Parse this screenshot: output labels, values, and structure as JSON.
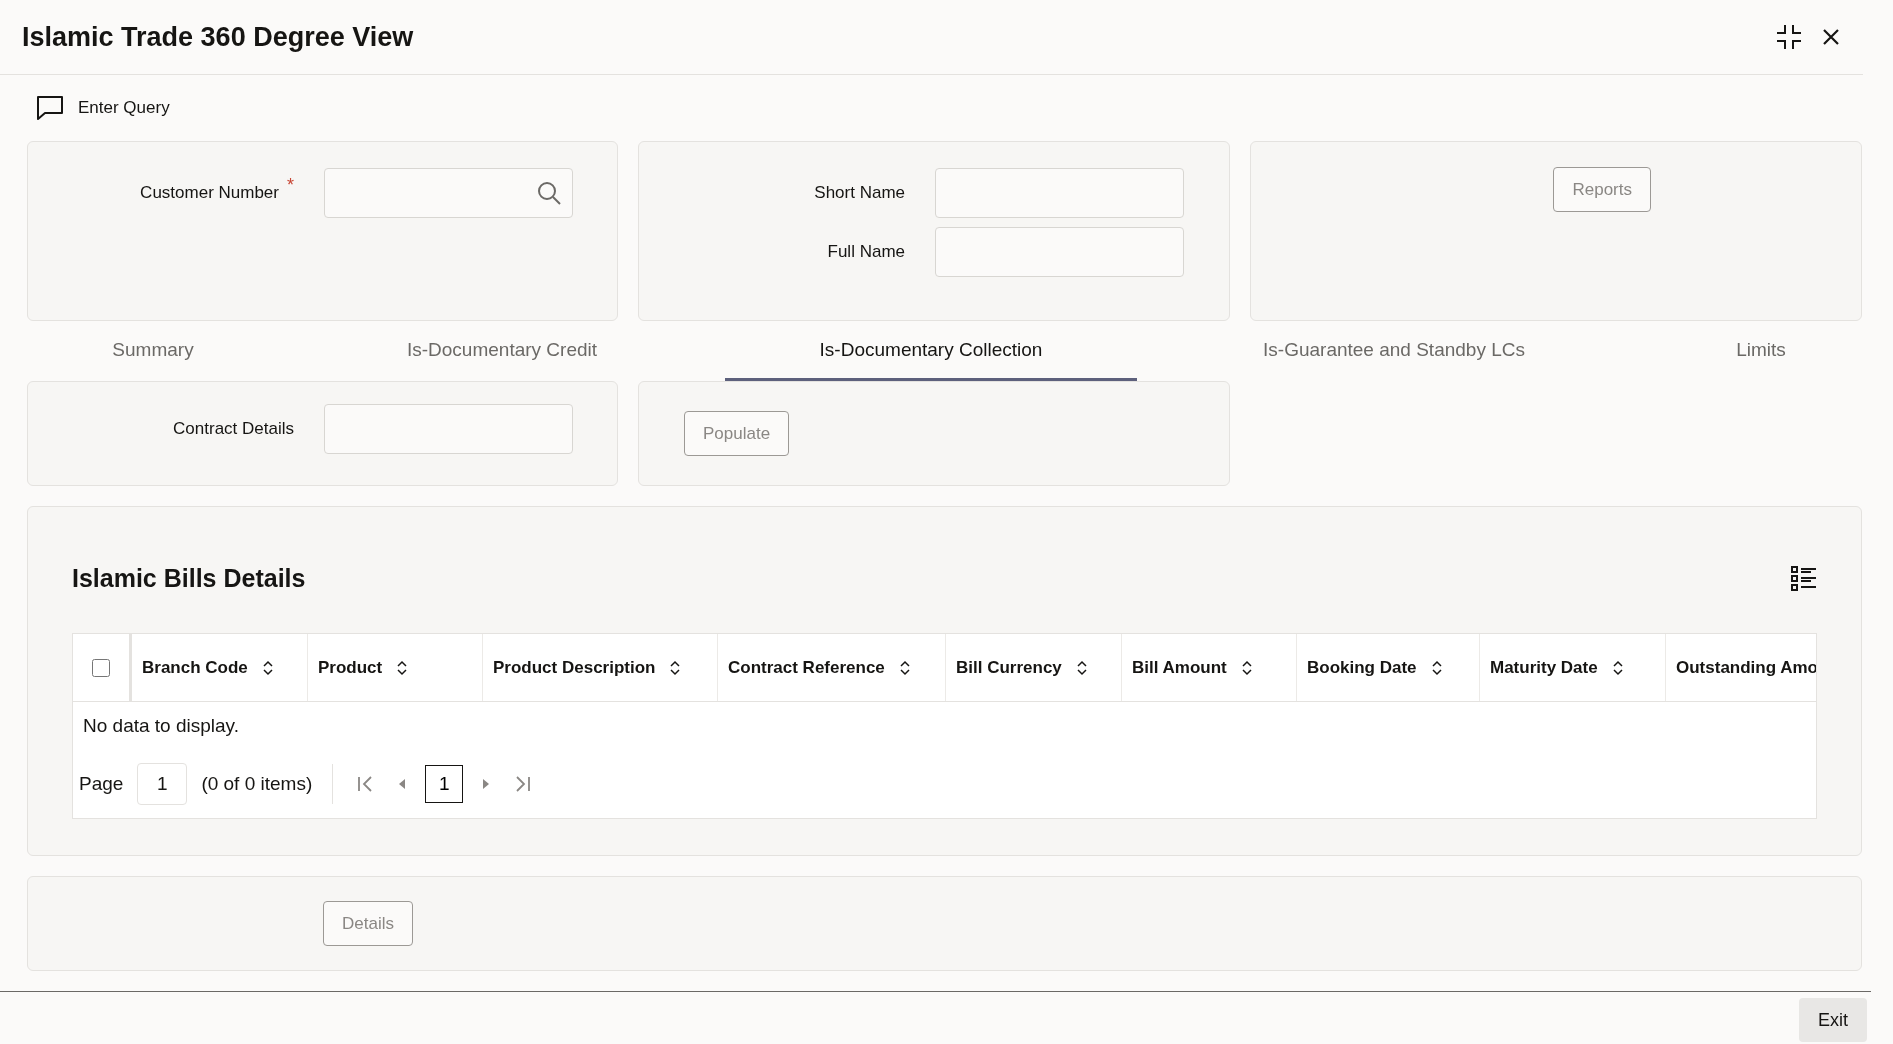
{
  "window": {
    "title": "Islamic Trade 360 Degree View"
  },
  "toolbar": {
    "enter_query": "Enter Query"
  },
  "customer": {
    "label": "Customer Number",
    "required_mark": "*"
  },
  "names": [
    {
      "label": "Short Name"
    },
    {
      "label": "Full Name"
    }
  ],
  "reports_button": "Reports",
  "tabs": [
    {
      "label": "Summary",
      "selected": false
    },
    {
      "label": "Is-Documentary Credit",
      "selected": false
    },
    {
      "label": "Is-Documentary Collection",
      "selected": true
    },
    {
      "label": "Is-Guarantee and Standby LCs",
      "selected": false
    },
    {
      "label": "Limits",
      "selected": false
    }
  ],
  "contract": {
    "label": "Contract Details"
  },
  "populate_button": "Populate",
  "bills": {
    "title": "Islamic Bills Details",
    "select_all_checked": false,
    "columns": [
      "Branch Code",
      "Product",
      "Product Description",
      "Contract Reference",
      "Bill Currency",
      "Bill Amount",
      "Booking Date",
      "Maturity Date",
      "Outstanding Amo"
    ],
    "empty_message": "No data to display.",
    "pagination": {
      "page_label": "Page",
      "page_value": "1",
      "items": "(0 of 0 items)",
      "current_page": "1"
    }
  },
  "details_button": "Details",
  "exit_button": "Exit"
}
